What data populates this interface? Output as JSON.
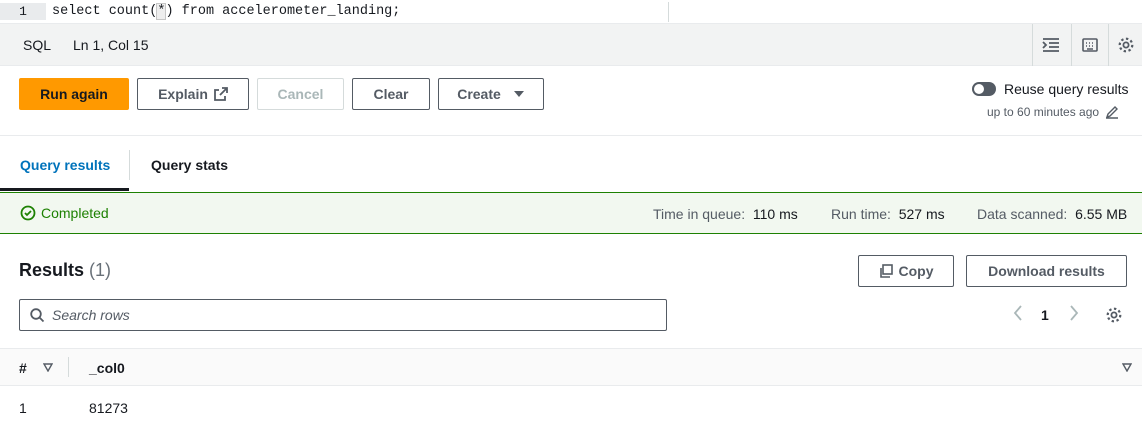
{
  "editor": {
    "line_number": "1",
    "code_before_cursor": "select count(",
    "code_cursor_char": "*",
    "code_after_cursor": ") from accelerometer_landing;"
  },
  "statusbar": {
    "language": "SQL",
    "position": "Ln 1, Col 15",
    "icons": [
      "indent-icon",
      "keyboard-icon",
      "settings-icon"
    ]
  },
  "toolbar": {
    "run_again": "Run again",
    "explain": "Explain",
    "cancel": "Cancel",
    "clear": "Clear",
    "create": "Create",
    "reuse_label": "Reuse query results",
    "reuse_sub": "up to 60 minutes ago",
    "reuse_enabled": false
  },
  "tabs": {
    "query_results": "Query results",
    "query_stats": "Query stats",
    "active": "query_results"
  },
  "banner": {
    "status": "Completed",
    "time_in_queue_label": "Time in queue:",
    "time_in_queue": "110 ms",
    "run_time_label": "Run time:",
    "run_time": "527 ms",
    "data_scanned_label": "Data scanned:",
    "data_scanned": "6.55 MB"
  },
  "results": {
    "title": "Results",
    "count": "(1)",
    "copy": "Copy",
    "download": "Download results",
    "search_placeholder": "Search rows",
    "page": "1",
    "columns": [
      "#",
      "_col0"
    ],
    "rows": [
      [
        "1",
        "81273"
      ]
    ]
  },
  "colors": {
    "primary": "#ff9900",
    "link_active": "#0073bb",
    "success": "#1d8102"
  }
}
